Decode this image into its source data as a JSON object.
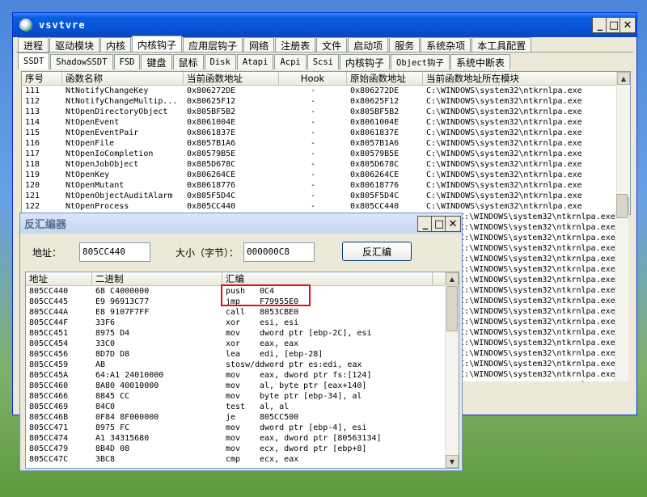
{
  "main_window": {
    "title": "vsvtvre",
    "controls": {
      "minimize": "_",
      "maximize": "□",
      "close": "✕"
    },
    "tabs_top": [
      "进程",
      "驱动模块",
      "内核",
      "内核钩子",
      "应用层钩子",
      "网络",
      "注册表",
      "文件",
      "启动项",
      "服务",
      "系统杂项",
      "本工具配置"
    ],
    "tabs_sub": [
      "SSDT",
      "ShadowSSDT",
      "FSD",
      "键盘",
      "鼠标",
      "Disk",
      "Atapi",
      "Acpi",
      "Scsi",
      "内核钩子",
      "Object钩子",
      "系统中断表"
    ],
    "table": {
      "columns": [
        "序号",
        "函数名称",
        "当前函数地址",
        "Hook",
        "原始函数地址",
        "当前函数地址所在模块"
      ],
      "rows": [
        [
          "111",
          "NtNotifyChangeKey",
          "0x806272DE",
          "-",
          "0x806272DE",
          "C:\\WINDOWS\\system32\\ntkrnlpa.exe"
        ],
        [
          "112",
          "NtNotifyChangeMultip...",
          "0x80625F12",
          "-",
          "0x80625F12",
          "C:\\WINDOWS\\system32\\ntkrnlpa.exe"
        ],
        [
          "113",
          "NtOpenDirectoryObject",
          "0x805BF5B2",
          "-",
          "0x805BF5B2",
          "C:\\WINDOWS\\system32\\ntkrnlpa.exe"
        ],
        [
          "114",
          "NtOpenEvent",
          "0x8061004E",
          "-",
          "0x8061004E",
          "C:\\WINDOWS\\system32\\ntkrnlpa.exe"
        ],
        [
          "115",
          "NtOpenEventPair",
          "0x8061837E",
          "-",
          "0x8061837E",
          "C:\\WINDOWS\\system32\\ntkrnlpa.exe"
        ],
        [
          "116",
          "NtOpenFile",
          "0x8057B1A6",
          "-",
          "0x8057B1A6",
          "C:\\WINDOWS\\system32\\ntkrnlpa.exe"
        ],
        [
          "117",
          "NtOpenIoCompletion",
          "0x80579B5E",
          "-",
          "0x80579B5E",
          "C:\\WINDOWS\\system32\\ntkrnlpa.exe"
        ],
        [
          "118",
          "NtOpenJobObject",
          "0x805D678C",
          "-",
          "0x805D678C",
          "C:\\WINDOWS\\system32\\ntkrnlpa.exe"
        ],
        [
          "119",
          "NtOpenKey",
          "0x806264CE",
          "-",
          "0x806264CE",
          "C:\\WINDOWS\\system32\\ntkrnlpa.exe"
        ],
        [
          "120",
          "NtOpenMutant",
          "0x80618776",
          "-",
          "0x80618776",
          "C:\\WINDOWS\\system32\\ntkrnlpa.exe"
        ],
        [
          "121",
          "NtOpenObjectAuditAlarm",
          "0x805F5D4C",
          "-",
          "0x805F5D4C",
          "C:\\WINDOWS\\system32\\ntkrnlpa.exe"
        ],
        [
          "122",
          "NtOpenProcess",
          "0x805CC440",
          "-",
          "0x805CC440",
          "C:\\WINDOWS\\system32\\ntkrnlpa.exe"
        ]
      ],
      "hidden_module_rows": [
        "C:\\WINDOWS\\system32\\ntkrnlpa.exe",
        "C:\\WINDOWS\\system32\\ntkrnlpa.exe",
        "C:\\WINDOWS\\system32\\ntkrnlpa.exe",
        "C:\\WINDOWS\\system32\\ntkrnlpa.exe",
        "C:\\WINDOWS\\system32\\ntkrnlpa.exe",
        "C:\\WINDOWS\\system32\\ntkrnlpa.exe",
        "C:\\WINDOWS\\system32\\ntkrnlpa.exe",
        "C:\\WINDOWS\\system32\\ntkrnlpa.exe",
        "C:\\WINDOWS\\system32\\ntkrnlpa.exe",
        "C:\\WINDOWS\\system32\\ntkrnlpa.exe",
        "C:\\WINDOWS\\system32\\ntkrnlpa.exe",
        "C:\\WINDOWS\\system32\\ntkrnlpa.exe",
        "C:\\WINDOWS\\system32\\ntkrnlpa.exe",
        "C:\\WINDOWS\\system32\\ntkrnlpa.exe",
        "C:\\WINDOWS\\system32\\ntkrnlpa.exe",
        "C:\\WINDOWS\\system32\\ntkrnlpa.exe",
        "C:\\WINDOWS\\system32\\ntkrnlpa.exe"
      ]
    }
  },
  "disasm_window": {
    "title": "反汇编器",
    "controls": {
      "minimize": "_",
      "maximize": "□",
      "close": "✕"
    },
    "address_label": "地址：",
    "address_value": "805CC440",
    "size_label": "大小（字节）：",
    "size_value": "000000C8",
    "disasm_button": "反汇编",
    "columns": [
      "地址",
      "二进制",
      "汇编"
    ],
    "rows": [
      [
        "805CC440",
        "68 C4000000",
        "push",
        "0C4"
      ],
      [
        "805CC445",
        "E9 96913C77",
        "jmp",
        "F79955E0"
      ],
      [
        "805CC44A",
        "E8 9107F7FF",
        "call",
        "8053CBE0"
      ],
      [
        "805CC44F",
        "33F6",
        "xor",
        "esi, esi"
      ],
      [
        "805CC451",
        "8975 D4",
        "mov",
        "dword ptr [ebp-2C], esi"
      ],
      [
        "805CC454",
        "33C0",
        "xor",
        "eax, eax"
      ],
      [
        "805CC456",
        "8D7D D8",
        "lea",
        "edi, [ebp-28]"
      ],
      [
        "805CC459",
        "AB",
        "stosw/d",
        "dword ptr es:edi, eax"
      ],
      [
        "805CC45A",
        "64:A1 24010000",
        "mov",
        "eax, dword ptr fs:[124]"
      ],
      [
        "805CC460",
        "8A80 40010000",
        "mov",
        "al, byte ptr [eax+140]"
      ],
      [
        "805CC466",
        "8845 CC",
        "mov",
        "byte ptr [ebp-34], al"
      ],
      [
        "805CC469",
        "84C0",
        "test",
        "al, al"
      ],
      [
        "805CC46B",
        "0F84 8F000000",
        "je",
        "805CC500"
      ],
      [
        "805CC471",
        "8975 FC",
        "mov",
        "dword ptr [ebp-4], esi"
      ],
      [
        "805CC474",
        "A1 34315680",
        "mov",
        "eax, dword ptr [80563134]"
      ],
      [
        "805CC479",
        "8B4D 08",
        "mov",
        "ecx, dword ptr [ebp+8]"
      ],
      [
        "805CC47C",
        "3BC8",
        "cmp",
        "ecx, eax"
      ]
    ],
    "highlight_color": "#e01010"
  }
}
